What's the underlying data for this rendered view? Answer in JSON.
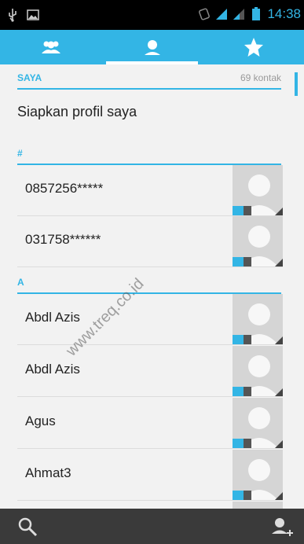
{
  "status_bar": {
    "time": "14:38"
  },
  "tabs": [
    {
      "name": "groups-icon",
      "active": false
    },
    {
      "name": "person-icon",
      "active": true
    },
    {
      "name": "star-icon",
      "active": false
    }
  ],
  "section_me": {
    "title": "SAYA",
    "count": "69 kontak"
  },
  "profile_label": "Siapkan profil saya",
  "sections": [
    {
      "title": "#",
      "contacts": [
        "0857256*****",
        "031758******"
      ]
    },
    {
      "title": "A",
      "contacts": [
        "Abdl Azis",
        "Abdl Azis",
        "Agus",
        "Ahmat3"
      ]
    }
  ],
  "watermark": "www.treq.co.id",
  "colors": {
    "accent": "#33b5e5",
    "background": "#f2f2f2",
    "bottom_bar": "#3a3a3a"
  }
}
